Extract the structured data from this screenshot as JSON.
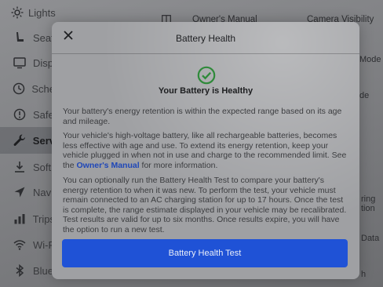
{
  "sidebar": {
    "items": [
      {
        "label": "Lights",
        "icon": "lights-icon"
      },
      {
        "label": "Seat",
        "icon": "seat-icon"
      },
      {
        "label": "Disp",
        "icon": "display-icon"
      },
      {
        "label": "Sche",
        "icon": "schedule-icon"
      },
      {
        "label": "Safe",
        "icon": "safety-icon"
      },
      {
        "label": "Serv",
        "icon": "wrench-icon",
        "active": true
      },
      {
        "label": "Soft",
        "icon": "download-icon"
      },
      {
        "label": "Navi",
        "icon": "navigation-icon"
      },
      {
        "label": "Trips",
        "icon": "trips-icon"
      },
      {
        "label": "Wi-F",
        "icon": "wifi-icon"
      },
      {
        "label": "Blue",
        "icon": "bluetooth-icon"
      }
    ]
  },
  "topbar": {
    "owners_manual": "Owner's Manual",
    "camera_visibility": "Camera Visibility"
  },
  "background_right": {
    "frag1": "Mode",
    "frag2": "de",
    "frag3": "ring",
    "frag4": "tion",
    "frag5": "Data",
    "frag6": "h"
  },
  "modal": {
    "title": "Battery Health",
    "status_title": "Your Battery is Healthy",
    "paragraph1": "Your battery's energy retention is within the expected range based on its age and mileage.",
    "paragraph2_before": "Your vehicle's high-voltage battery, like all rechargeable batteries, becomes less effective with age and use. To extend its energy retention, keep your vehicle plugged in when not in use and charge to the recommended limit. See the ",
    "paragraph2_link": "Owner's Manual",
    "paragraph2_after": " for more information.",
    "paragraph3": "You can optionally run the Battery Health Test to compare your battery's energy retention to when it was new. To perform the test, your vehicle must remain connected to an AC charging station for up to 17 hours. Once the test is complete, the range estimate displayed in your vehicle may be recalibrated. Test results are valid for up to six months. Once results expire, you will have the option to run a new test.",
    "button_label": "Battery Health Test"
  },
  "colors": {
    "accent_button": "#1f52d6",
    "success_check": "#2f8a3a",
    "link": "#1f47b8"
  }
}
